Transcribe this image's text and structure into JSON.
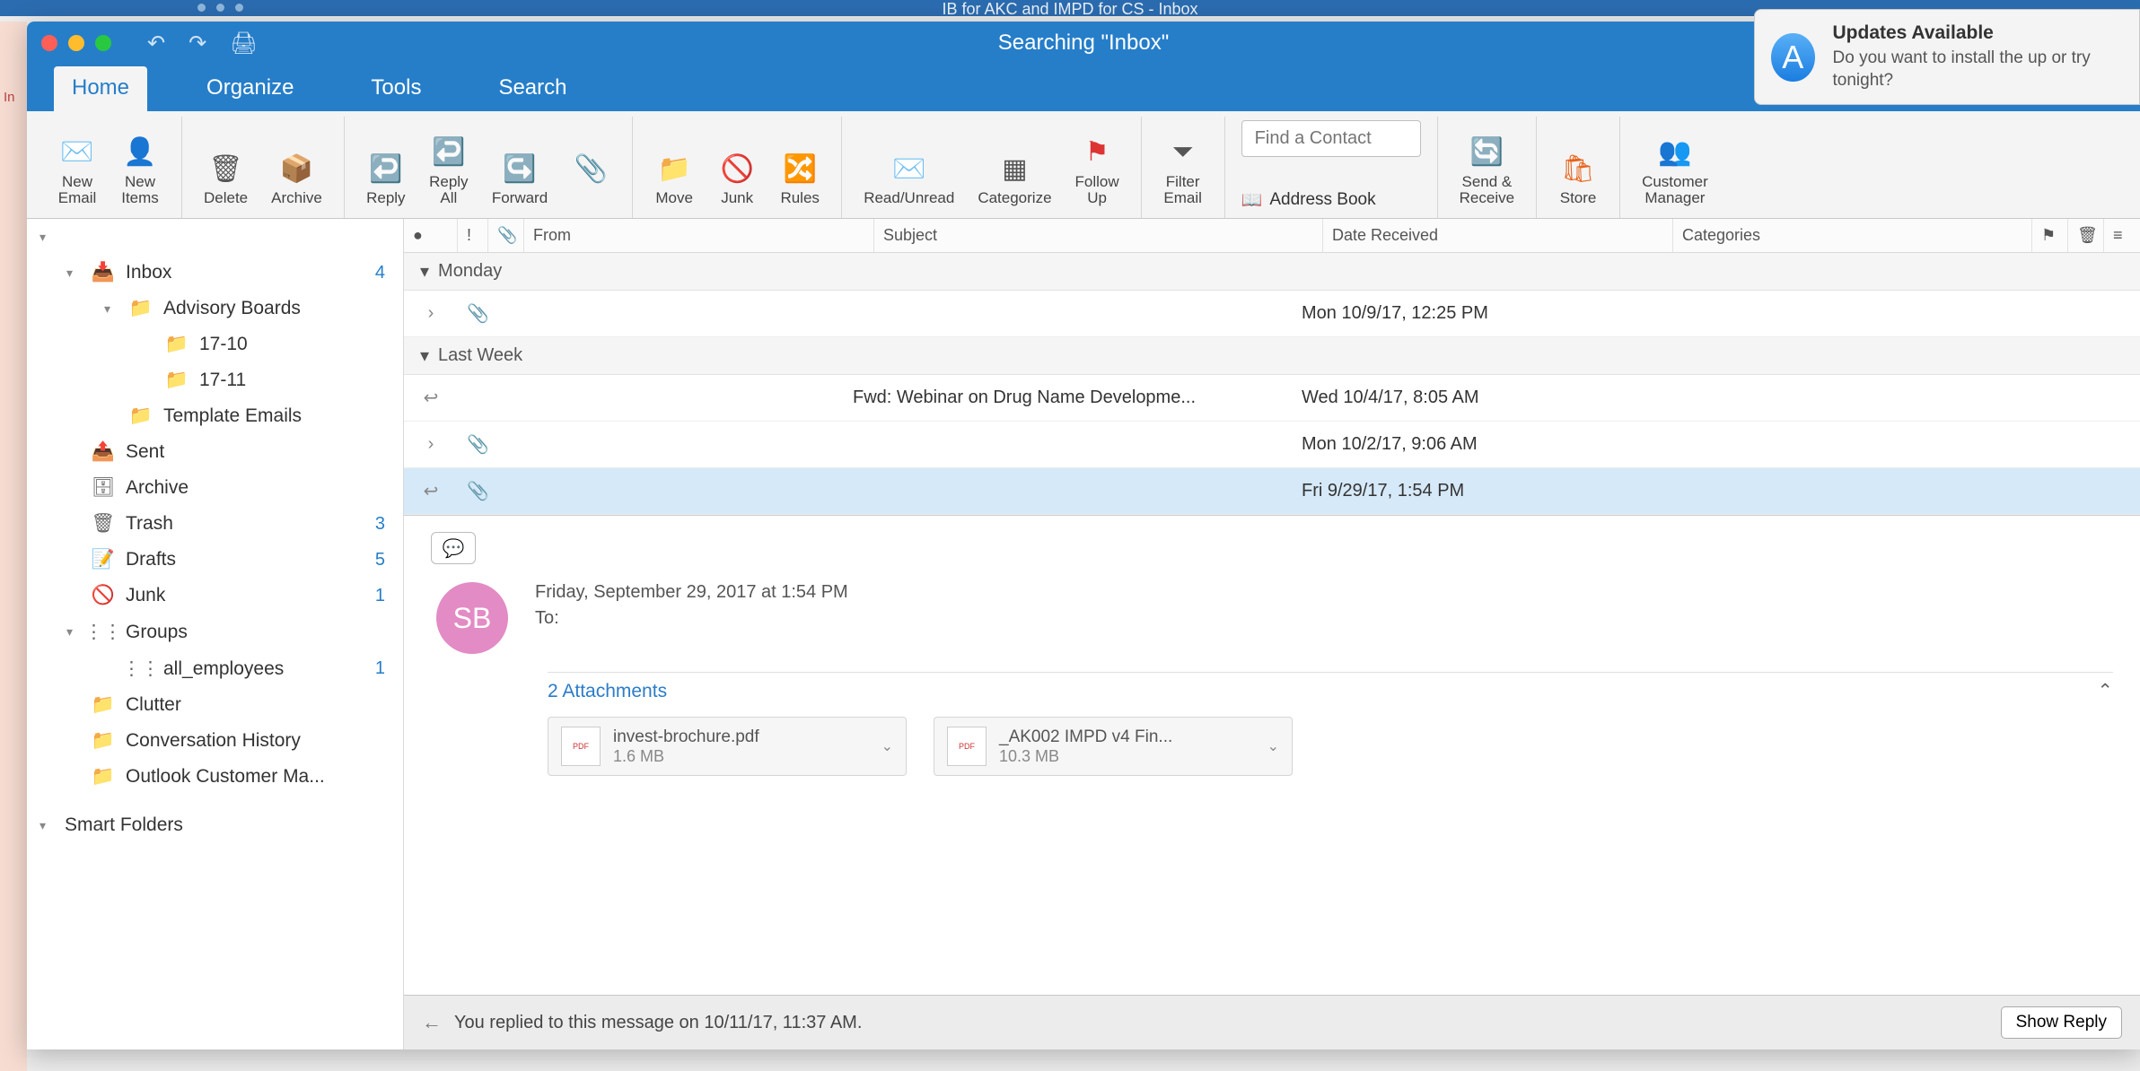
{
  "back_window_title": "IB for AKC and IMPD for CS - Inbox",
  "update": {
    "title": "Updates Available",
    "body": "Do you want to install the up or try tonight?"
  },
  "window_title": "Searching \"Inbox\"",
  "tabs": [
    "Home",
    "Organize",
    "Tools",
    "Search"
  ],
  "ribbon": {
    "new_email": "New\nEmail",
    "new_items": "New\nItems",
    "delete": "Delete",
    "archive": "Archive",
    "reply": "Reply",
    "reply_all": "Reply\nAll",
    "forward": "Forward",
    "move": "Move",
    "junk": "Junk",
    "rules": "Rules",
    "read_unread": "Read/Unread",
    "categorize": "Categorize",
    "follow_up": "Follow\nUp",
    "filter_email": "Filter\nEmail",
    "find_contact_ph": "Find a Contact",
    "address_book": "Address Book",
    "send_receive": "Send &\nReceive",
    "store": "Store",
    "customer_mgr": "Customer\nManager"
  },
  "columns": {
    "from": "From",
    "subject": "Subject",
    "date": "Date Received",
    "categories": "Categories"
  },
  "sidebar": {
    "inbox": "Inbox",
    "inbox_count": "4",
    "advisory": "Advisory Boards",
    "f1710": "17-10",
    "f1711": "17-11",
    "templates": "Template Emails",
    "sent": "Sent",
    "archive": "Archive",
    "trash": "Trash",
    "trash_count": "3",
    "drafts": "Drafts",
    "drafts_count": "5",
    "junk": "Junk",
    "junk_count": "1",
    "groups": "Groups",
    "all_emp": "all_employees",
    "all_emp_count": "1",
    "clutter": "Clutter",
    "conv_hist": "Conversation History",
    "ocm": "Outlook Customer Ma...",
    "smart": "Smart Folders"
  },
  "groups_hdr": {
    "monday": "Monday",
    "last_week": "Last Week"
  },
  "messages": {
    "r1_date": "Mon 10/9/17, 12:25 PM",
    "r2_subj": "Fwd: Webinar on Drug Name Developme...",
    "r2_date": "Wed 10/4/17, 8:05 AM",
    "r3_date": "Mon 10/2/17, 9:06 AM",
    "r4_date": "Fri 9/29/17, 1:54 PM"
  },
  "reading": {
    "avatar": "SB",
    "sent_line": "Friday, September 29, 2017 at 1:54 PM",
    "to_label": "To:",
    "att_header": "2 Attachments",
    "att1_name": "invest-brochure.pdf",
    "att1_size": "1.6 MB",
    "att2_name": "_AK002 IMPD v4 Fin...",
    "att2_size": "10.3 MB",
    "reply_msg": "You replied to this message on 10/11/17, 11:37 AM.",
    "show_reply": "Show Reply"
  }
}
